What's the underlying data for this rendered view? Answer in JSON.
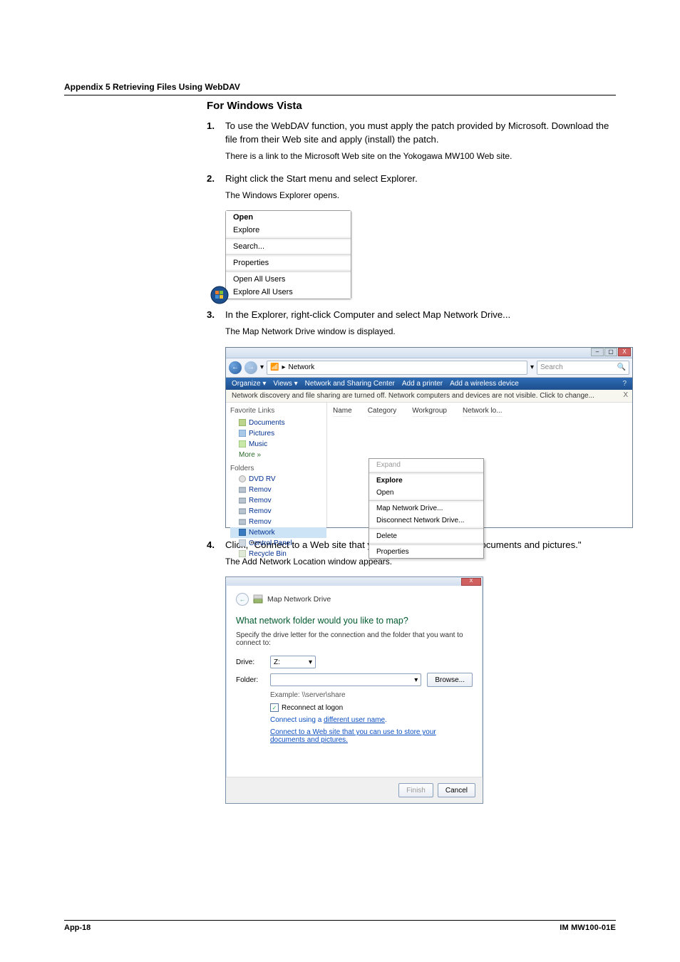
{
  "appendix_title": "Appendix 5  Retrieving Files Using WebDAV",
  "section_heading": "For Windows Vista",
  "steps": {
    "s1": {
      "num": "1.",
      "text": "To use the WebDAV function, you must apply the patch provided by Microsoft. Download the file from their Web site and apply (install) the patch.",
      "note": "There is a link to the Microsoft Web site on the Yokogawa MW100 Web site."
    },
    "s2": {
      "num": "2.",
      "text": "Right click the Start menu and select Explorer.",
      "note": "The Windows Explorer opens."
    },
    "s3": {
      "num": "3.",
      "text": "In the Explorer, right-click Computer and select Map Network Drive...",
      "note": "The Map Network Drive window is displayed."
    },
    "s4": {
      "num": "4.",
      "text": "Click, \"Connect to a Web site that you can use to store your documents and pictures.\"",
      "note": "The Add Network Location window appears."
    }
  },
  "ss1_menu": {
    "open": "Open",
    "explore": "Explore",
    "search": "Search...",
    "properties": "Properties",
    "open_all": "Open All Users",
    "explore_all": "Explore All Users"
  },
  "ss2": {
    "crumb": "Network",
    "crumb_arrow": "▸",
    "search_placeholder": "Search",
    "search_icon": "🔍",
    "refresh_dd": "▾",
    "toolbar": {
      "organize": "Organize ▾",
      "views": "Views ▾",
      "nsc": "Network and Sharing Center",
      "addp": "Add a printer",
      "addw": "Add a wireless device"
    },
    "infobar": "Network discovery and file sharing are turned off. Network computers and devices are not visible. Click to change...",
    "infobar_x": "X",
    "left": {
      "favorite": "Favorite Links",
      "documents": "Documents",
      "pictures": "Pictures",
      "music": "Music",
      "more": "More »",
      "folders": "Folders",
      "dvd": "DVD RV",
      "remov": "Remov",
      "network": "Network",
      "cpanel": "Control Panel",
      "recycle": "Recycle Bin"
    },
    "cols": {
      "name": "Name",
      "category": "Category",
      "workgroup": "Workgroup",
      "netloc": "Network lo..."
    },
    "ctx": {
      "expand": "Expand",
      "explore": "Explore",
      "open": "Open",
      "map": "Map Network Drive...",
      "disconnect": "Disconnect Network Drive...",
      "delete": "Delete",
      "properties": "Properties"
    }
  },
  "ss3": {
    "title": "Map Network Drive",
    "question": "What network folder would you like to map?",
    "sub": "Specify the drive letter for the connection and the folder that you want to connect to:",
    "drive_lbl": "Drive:",
    "drive_val": "Z:",
    "folder_lbl": "Folder:",
    "browse": "Browse...",
    "example": "Example: \\\\server\\share",
    "reconnect": "Reconnect at logon",
    "diffuser_pre": "Connect using a ",
    "diffuser_link": "different user name",
    "diffuser_post": ".",
    "weblink": "Connect to a Web site that you can use to store your documents and pictures.",
    "finish": "Finish",
    "cancel": "Cancel",
    "dd": "▾",
    "check": "✓",
    "close_x": "X"
  },
  "footer": {
    "left": "App-18",
    "right": "IM MW100-01E"
  },
  "icons": {
    "arrow_left": "←",
    "arrow_right": "→",
    "net": "📶",
    "help": "?"
  }
}
